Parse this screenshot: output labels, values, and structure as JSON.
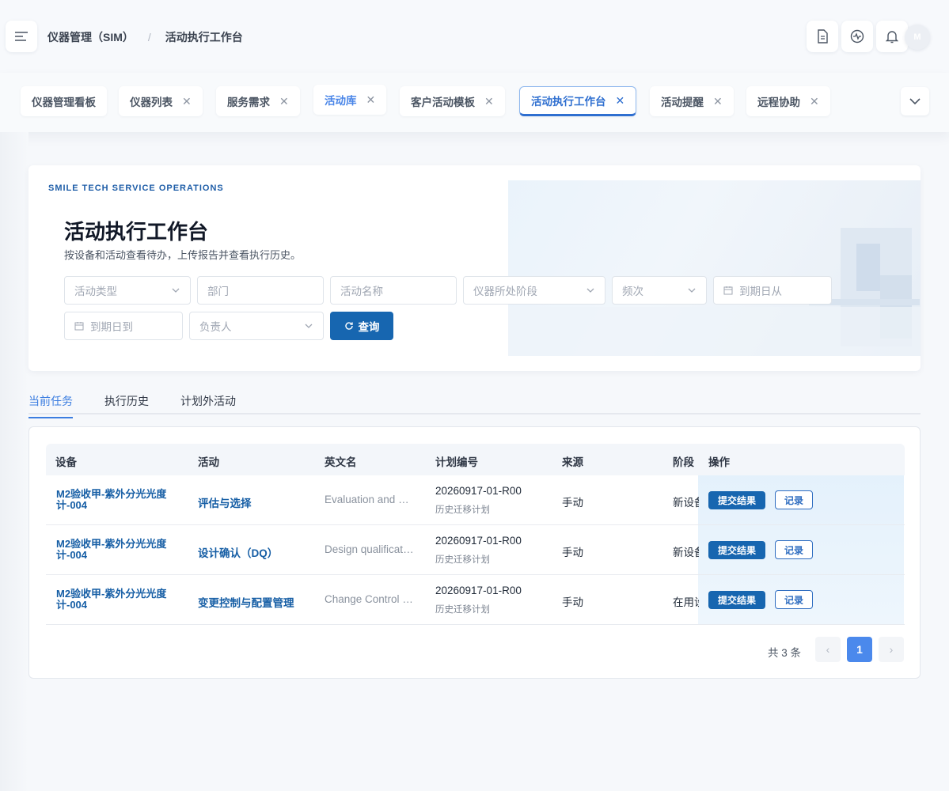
{
  "header": {
    "breadcrumb": [
      "仪器管理（SIM）",
      "活动执行工作台"
    ],
    "breadcrumb_sep": "/",
    "avatar_initial": "M"
  },
  "tabs": [
    {
      "label": "仪器管理看板",
      "closable": false
    },
    {
      "label": "仪器列表",
      "closable": true
    },
    {
      "label": "服务需求",
      "closable": true
    },
    {
      "label": "活动库",
      "closable": true
    },
    {
      "label": "客户活动模板",
      "closable": true
    },
    {
      "label": "活动执行工作台",
      "closable": true,
      "active": true
    },
    {
      "label": "活动提醒",
      "closable": true
    },
    {
      "label": "远程协助",
      "closable": true
    }
  ],
  "hero": {
    "eyebrow": "SMILE TECH SERVICE OPERATIONS",
    "title": "活动执行工作台",
    "subtitle": "按设备和活动查看待办，上传报告并查看执行历史。"
  },
  "filters": {
    "activity_type": "活动类型",
    "department": "部门",
    "activity_name": "活动名称",
    "stage": "仪器所处阶段",
    "frequency": "频次",
    "due_from": "到期日从",
    "due_to": "到期日到",
    "owner": "负责人",
    "query_label": "查询"
  },
  "subtabs": [
    "当前任务",
    "执行历史",
    "计划外活动"
  ],
  "table": {
    "columns": [
      "设备",
      "活动",
      "英文名",
      "计划编号",
      "来源",
      "阶段",
      "操作"
    ],
    "rows": [
      {
        "device": "M2验收甲-紫外分光光度计-004",
        "activity": "评估与选择",
        "english": "Evaluation and Selection",
        "plan": "20260917-01-R00",
        "plan_sub": "历史迁移计划",
        "source": "手动",
        "stage": "新设备"
      },
      {
        "device": "M2验收甲-紫外分光光度计-004",
        "activity": "设计确认（DQ）",
        "english": "Design qualification",
        "plan": "20260917-01-R00",
        "plan_sub": "历史迁移计划",
        "source": "手动",
        "stage": "新设备"
      },
      {
        "device": "M2验收甲-紫外分光光度计-004",
        "activity": "变更控制与配置管理",
        "english": "Change Control and Configuration",
        "plan": "20260917-01-R00",
        "plan_sub": "历史迁移计划",
        "source": "手动",
        "stage": "在用设备"
      }
    ],
    "submit_label": "提交结果",
    "record_label": "记录"
  },
  "pagination": {
    "total_text": "共 3 条",
    "current_page": "1",
    "prev": "‹",
    "next": "›"
  }
}
